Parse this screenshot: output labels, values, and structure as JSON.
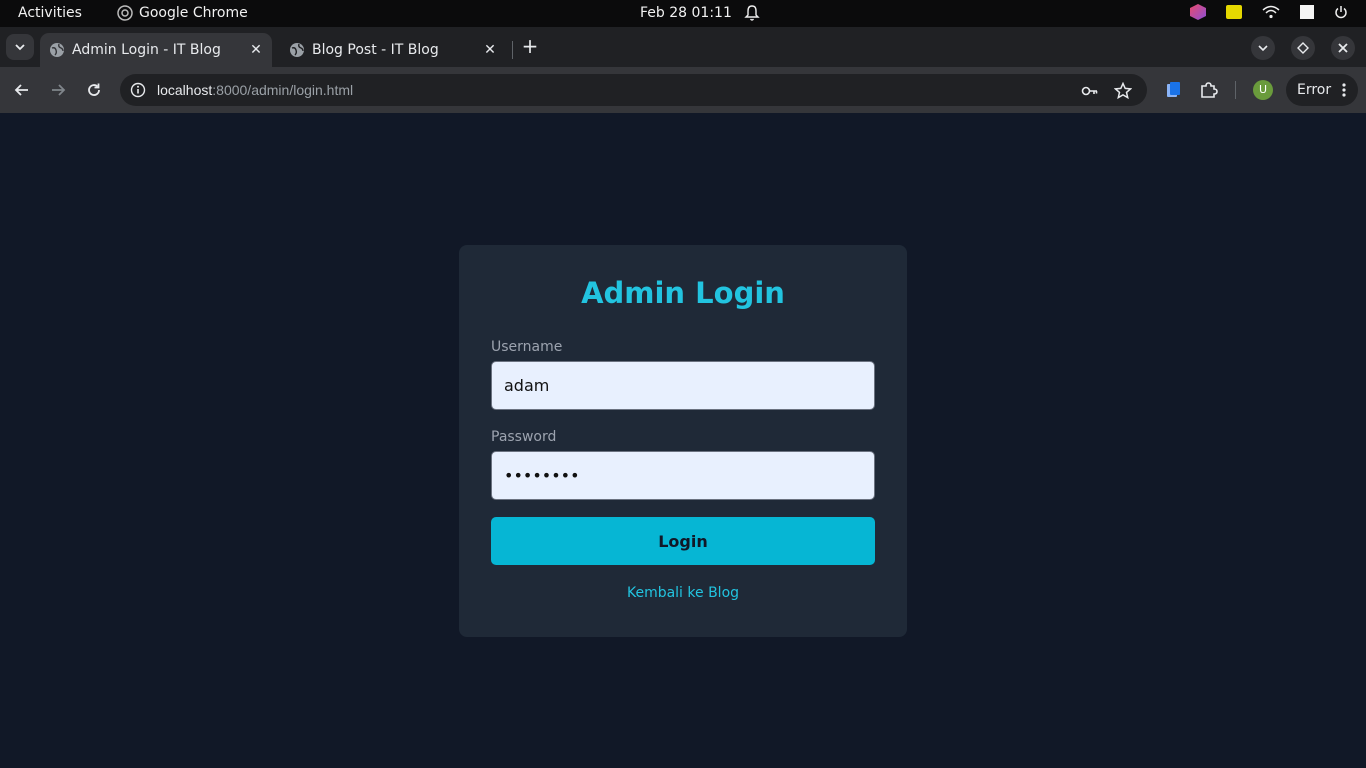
{
  "system_bar": {
    "activities": "Activities",
    "app_name": "Google Chrome",
    "clock": "Feb 28  01:11"
  },
  "tabs": [
    {
      "title": "Admin Login - IT Blog",
      "active": true
    },
    {
      "title": "Blog Post - IT Blog",
      "active": false
    }
  ],
  "toolbar": {
    "url_host": "localhost",
    "url_path": ":8000/admin/login.html",
    "avatar_letter": "U",
    "profile_status": "Error"
  },
  "login": {
    "heading": "Admin Login",
    "username_label": "Username",
    "username_value": "adam",
    "password_label": "Password",
    "password_value": "********",
    "submit_label": "Login",
    "back_link": "Kembali ke Blog"
  },
  "colors": {
    "page_bg": "#111827",
    "card_bg": "#1f2937",
    "accent": "#22c4e0",
    "button": "#06b6d4",
    "input_bg": "#e8f0fe"
  }
}
